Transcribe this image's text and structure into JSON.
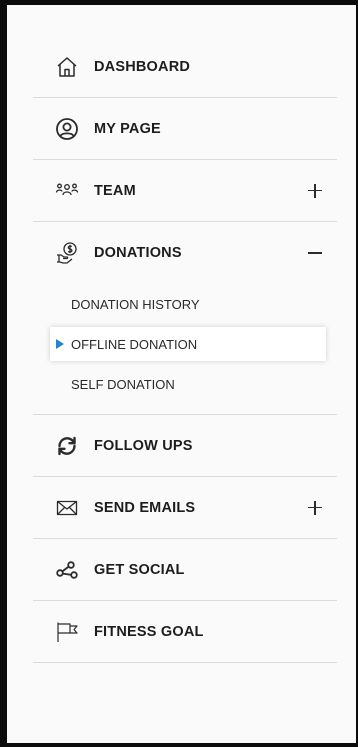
{
  "menu": {
    "items": [
      {
        "label": "DASHBOARD",
        "icon": "home-icon"
      },
      {
        "label": "MY PAGE",
        "icon": "user-circle-icon"
      },
      {
        "label": "TEAM",
        "icon": "team-icon",
        "toggle": "+"
      },
      {
        "label": "DONATIONS",
        "icon": "donation-hand-icon",
        "toggle": "−"
      },
      {
        "label": "FOLLOW UPS",
        "icon": "refresh-icon"
      },
      {
        "label": "SEND EMAILS",
        "icon": "envelope-icon",
        "toggle": "+"
      },
      {
        "label": "GET SOCIAL",
        "icon": "share-icon"
      },
      {
        "label": "FITNESS GOAL",
        "icon": "flag-icon"
      }
    ],
    "donations_submenu": [
      {
        "label": "DONATION HISTORY",
        "active": false
      },
      {
        "label": "OFFLINE DONATION",
        "active": true
      },
      {
        "label": "SELF DONATION",
        "active": false
      }
    ]
  },
  "colors": {
    "frame": "#0c0c0c",
    "background": "#fafafa",
    "active_arrow": "#2a83c7",
    "divider": "#dcdcdc"
  }
}
